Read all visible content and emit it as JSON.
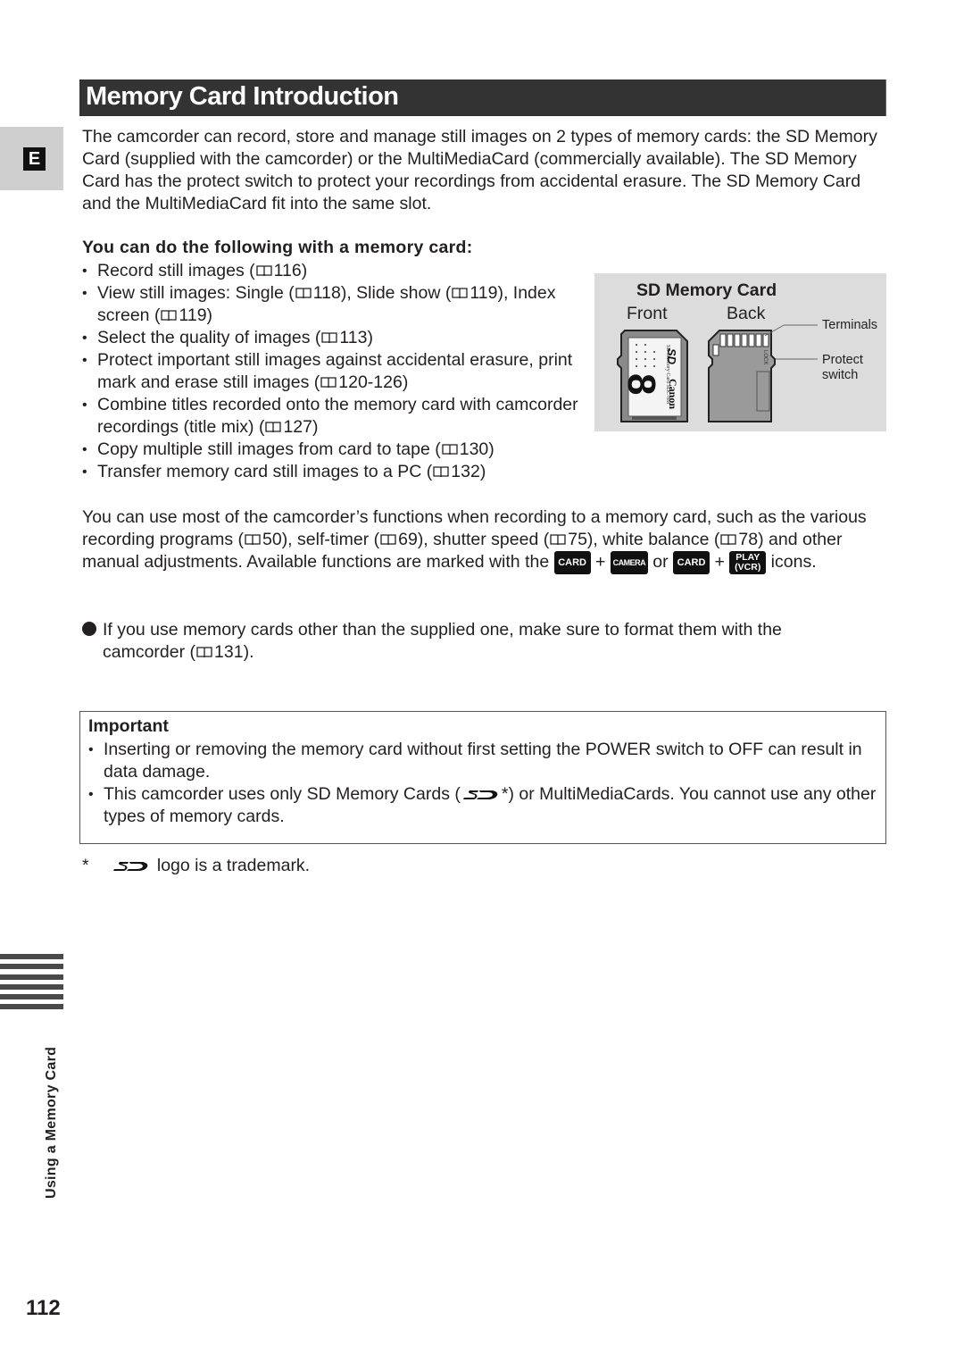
{
  "header": {
    "title": "Memory Card Introduction",
    "language_tab": "E"
  },
  "intro": "The camcorder can record, store and manage still images on 2 types of memory cards: the SD Memory Card (supplied with the camcorder) or the MultiMediaCard (commercially available). The SD Memory Card has the protect switch to protect your recordings from accidental erasure. The SD Memory Card and the MultiMediaCard fit into the same slot.",
  "features": {
    "heading": "You can do the following with a memory card:",
    "items": [
      {
        "parts": [
          "Record still images (",
          {
            "ref": "116"
          },
          ")"
        ]
      },
      {
        "parts": [
          "View still images: Single (",
          {
            "ref": "118"
          },
          "), Slide show (",
          {
            "ref": "119"
          },
          "), Index screen (",
          {
            "ref": "119"
          },
          ")"
        ]
      },
      {
        "parts": [
          "Select the quality of images (",
          {
            "ref": "113"
          },
          ")"
        ]
      },
      {
        "parts": [
          "Protect important still images against accidental erasure, print mark and erase still images (",
          {
            "ref": "120-126"
          },
          ")"
        ]
      },
      {
        "parts": [
          "Combine titles recorded onto the memory card with camcorder recordings (title mix) (",
          {
            "ref": "127"
          },
          ")"
        ]
      },
      {
        "parts": [
          "Copy multiple still images from card to tape (",
          {
            "ref": "130"
          },
          ")"
        ]
      },
      {
        "parts": [
          "Transfer memory card still images to a PC (",
          {
            "ref": "132"
          },
          ")"
        ]
      }
    ]
  },
  "figure": {
    "title": "SD Memory Card",
    "front_label": "Front",
    "back_label": "Back",
    "terminals_label": "Terminals",
    "protect_label_line1": "Protect",
    "protect_label_line2": "switch",
    "card_brand": "Canon",
    "card_model": "SD Memory Card SDC-8M",
    "card_capacity": "8",
    "lock_text": "LOCK"
  },
  "functions_paragraph": {
    "parts": [
      "You can use most of the camcorder’s functions when recording to a memory card, such as the various recording programs (",
      {
        "ref": "50"
      },
      "), self-timer (",
      {
        "ref": "69"
      },
      "), shutter speed (",
      {
        "ref": "75"
      },
      "), white balance (",
      {
        "ref": "78"
      },
      ") and other manual adjustments. Available functions are marked with the ",
      {
        "chip": "card"
      },
      " + ",
      {
        "chip": "camera"
      },
      " or ",
      {
        "chip": "card"
      },
      " + ",
      {
        "chip": "play"
      },
      " icons."
    ],
    "chips": {
      "card": "CARD",
      "camera": "CAMERA",
      "play_line1": "PLAY",
      "play_line2": "(VCR)"
    }
  },
  "note": {
    "parts": [
      "If you use memory cards other than the supplied one, make sure to format them with the camcorder (",
      {
        "ref": "131"
      },
      ")."
    ]
  },
  "important": {
    "title": "Important",
    "items": [
      {
        "parts": [
          "Inserting or removing the memory card without first setting the POWER switch to OFF can result in data damage."
        ]
      },
      {
        "parts": [
          "This camcorder uses only SD Memory Cards (",
          {
            "sdlogo": true
          },
          "*) or MultiMediaCards. You cannot use any other types of memory cards."
        ]
      }
    ]
  },
  "footnote": {
    "asterisk": "*",
    "text": "logo is a trademark."
  },
  "sidebar": {
    "section_label": "Using a Memory Card"
  },
  "page_number": "112"
}
